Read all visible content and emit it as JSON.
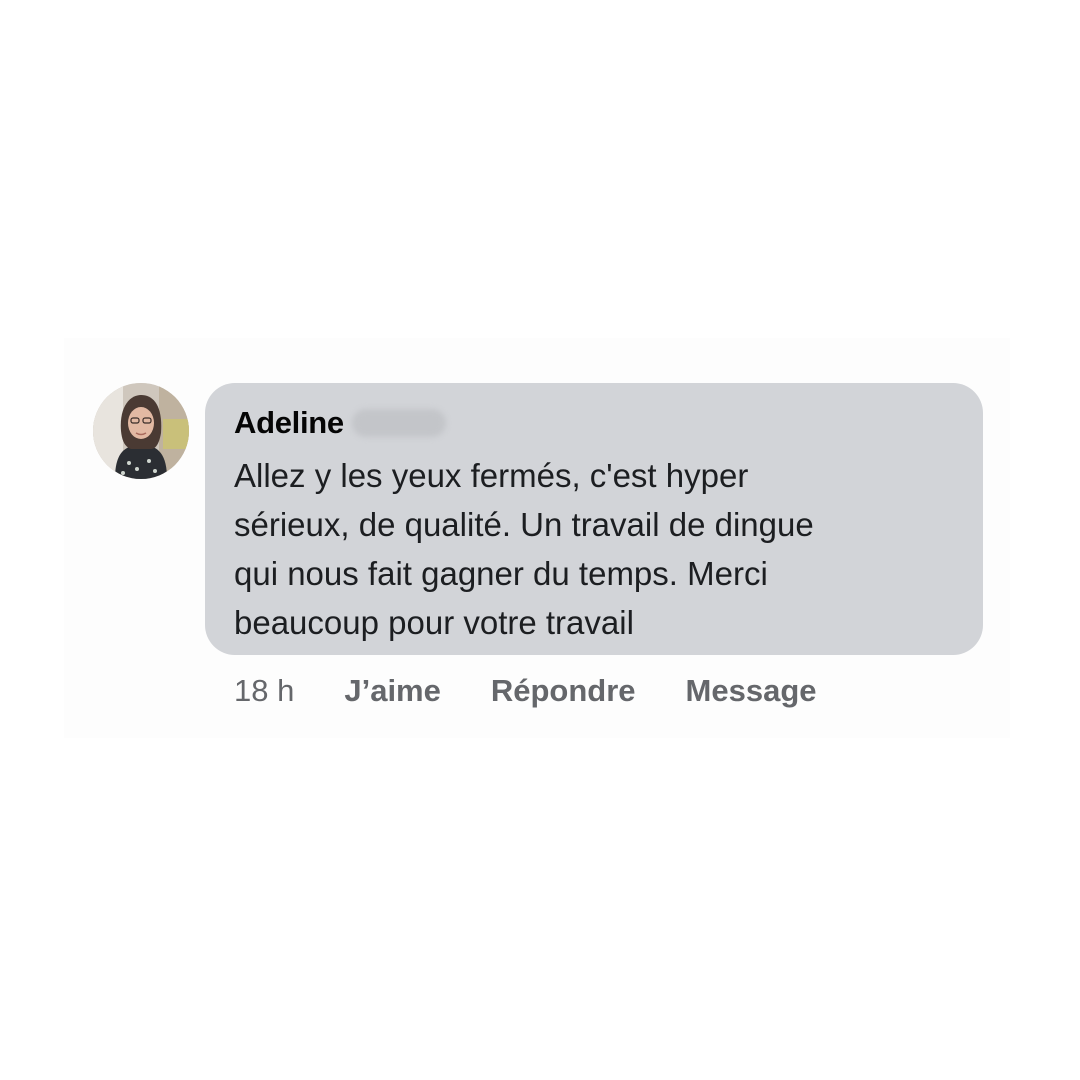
{
  "comment": {
    "author": {
      "first_name": "Adeline",
      "avatar_icon": "profile-photo-icon"
    },
    "text": "Allez y les yeux fermés, c'est hyper\nsérieux, de qualité. Un travail de dingue\nqui nous fait gagner du temps. Merci\nbeaucoup pour votre travail",
    "timestamp": "18 h",
    "actions": {
      "like_label": "J’aime",
      "reply_label": "Répondre",
      "message_label": "Message"
    }
  },
  "colors": {
    "bubble_background": "#d2d4d8",
    "secondary_text": "#65676b",
    "primary_text": "#050505"
  }
}
